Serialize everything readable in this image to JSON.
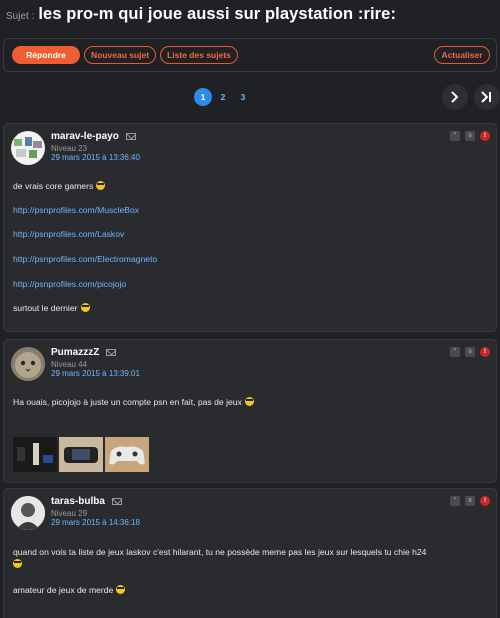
{
  "topic": {
    "prefix": "Sujet :",
    "title": "les pro-m qui joue aussi sur playstation :rire:"
  },
  "toolbar": {
    "reply": "Répondre",
    "new_topic": "Nouveau sujet",
    "topic_list": "Liste des sujets",
    "refresh": "Actualiser"
  },
  "pagination": {
    "pages": [
      "1",
      "2",
      "3"
    ],
    "active": "1",
    "next_icon": "chevron-right-icon",
    "last_icon": "last-page-icon"
  },
  "posts": [
    {
      "author": "marav-le-payo",
      "level": "Niveau 23",
      "date": "29 mars 2015 à 13:36:40",
      "lines": [
        "de vrais core gamers",
        "http://psnprofiles.com/MuscleBox",
        "http://psnprofiles.com/Laskov",
        "http://psnprofiles.com/Electromagneto",
        "http://psnprofiles.com/picojojo",
        "surtout le dernier"
      ]
    },
    {
      "author": "PumazzzZ",
      "level": "Niveau 44",
      "date": "29 mars 2015 à 13:39:01",
      "lines": [
        "Ha ouais, picojojo à juste un compte psn en fait, pas de jeux"
      ],
      "thumbnails": [
        "console-photo",
        "handheld-photo",
        "controller-photo"
      ]
    },
    {
      "author": "taras-bulba",
      "level": "Niveau 29",
      "date": "29 mars 2015 à 14:36:18",
      "lines": [
        "quand on vois ta liste de jeux laskov c'est hilarant, tu ne possède meme pas les jeux sur lesquels tu chie h24",
        "amateur de jeux de merde"
      ]
    }
  ],
  "icons": {
    "message": "mail-icon",
    "quote": "quote-icon",
    "menu": "menu-icon",
    "report": "alert-icon"
  },
  "colors": {
    "background": "#202124",
    "panel": "#2a2b2e",
    "accent": "#f15d33",
    "link": "#6fb7ff",
    "active_page": "#2e8ae6"
  }
}
